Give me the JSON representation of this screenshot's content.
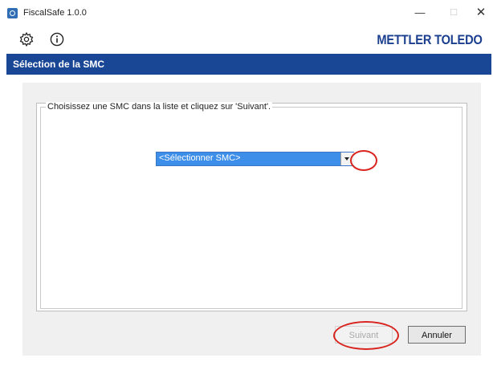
{
  "window": {
    "title": "FiscalSafe 1.0.0",
    "minimize": "—",
    "maximize": "☐",
    "close": "✕"
  },
  "toolbar": {
    "icons": [
      "gear-icon",
      "info-icon"
    ],
    "brand": "METTLER TOLEDO"
  },
  "header": {
    "title": "Sélection de la SMC"
  },
  "group": {
    "legend": "Choisissez une SMC dans la liste et cliquez sur 'Suivant'."
  },
  "smc_select": {
    "selected": "<Sélectionner SMC>"
  },
  "buttons": {
    "next": "Suivant",
    "cancel": "Annuler"
  },
  "colors": {
    "header_bar": "#1a4696",
    "brand": "#1b3f8f",
    "selection": "#3d8ee8",
    "annotation": "#d9231e"
  }
}
